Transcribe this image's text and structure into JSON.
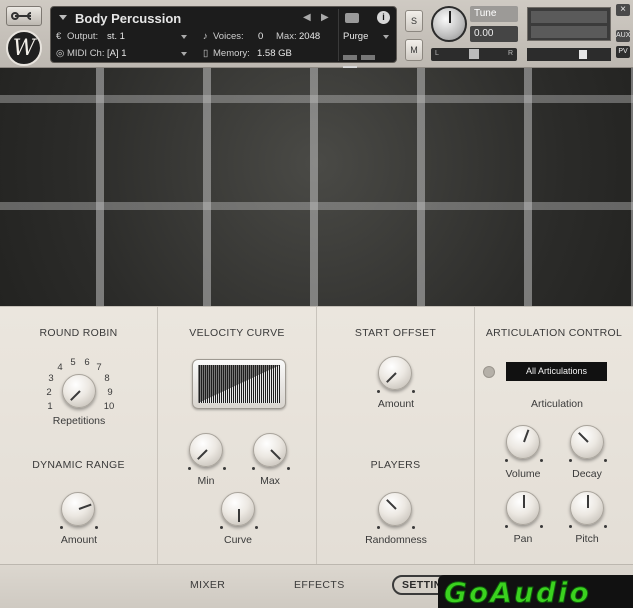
{
  "header": {
    "instrument_name": "Body Percussion",
    "output_label": "Output:",
    "output_value": "st. 1",
    "midi_label": "MIDI Ch:",
    "midi_value": "[A] 1",
    "voices_label": "Voices:",
    "voices_value": "0",
    "max_label": "Max:",
    "max_value": "2048",
    "memory_label": "Memory:",
    "memory_value": "1.58 GB",
    "purge_label": "Purge",
    "solo_label": "S",
    "mute_label": "M",
    "tune_label": "Tune",
    "tune_value": "0.00",
    "pan_left": "L",
    "pan_right": "R",
    "close_label": "×",
    "aux_label": "AUX",
    "pv_label": "PV",
    "logo_letter": "W"
  },
  "round_robin": {
    "title": "ROUND ROBIN",
    "numbers": [
      "1",
      "2",
      "3",
      "4",
      "5",
      "6",
      "7",
      "8",
      "9",
      "10"
    ],
    "knob_label": "Repetitions"
  },
  "dynamic_range": {
    "title": "DYNAMIC RANGE",
    "knob_label": "Amount"
  },
  "velocity_curve": {
    "title": "VELOCITY CURVE",
    "min_label": "Min",
    "max_label": "Max",
    "curve_label": "Curve"
  },
  "start_offset": {
    "title": "START OFFSET",
    "knob_label": "Amount"
  },
  "players": {
    "title": "PLAYERS",
    "knob_label": "Randomness"
  },
  "articulation_control": {
    "title": "ARTICULATION CONTROL",
    "dropdown_value": "All Articulations",
    "subtitle": "Articulation",
    "volume_label": "Volume",
    "decay_label": "Decay",
    "pan_label": "Pan",
    "pitch_label": "Pitch"
  },
  "footer": {
    "tabs": [
      "MIXER",
      "EFFECTS",
      "SETTINGS"
    ],
    "active_tab": "SETTINGS",
    "watermark": "GoAudio"
  },
  "colors": {
    "panel_bg": "#e8e3db",
    "display_bg": "#1c1c1c",
    "watermark_green": "#3bd21f"
  }
}
